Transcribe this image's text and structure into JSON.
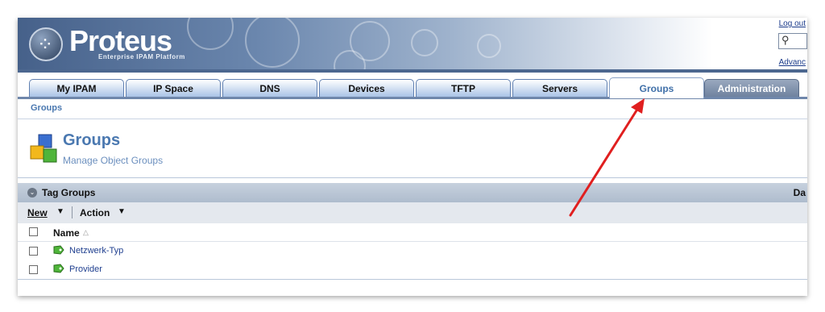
{
  "header": {
    "logo_title": "Proteus",
    "logo_subtitle": "Enterprise IPAM Platform",
    "logout_label": "Log out",
    "advanced_label": "Advanc"
  },
  "tabs": [
    {
      "label": "My IPAM"
    },
    {
      "label": "IP Space"
    },
    {
      "label": "DNS"
    },
    {
      "label": "Devices"
    },
    {
      "label": "TFTP"
    },
    {
      "label": "Servers"
    },
    {
      "label": "Groups"
    },
    {
      "label": "Administration"
    }
  ],
  "active_tab": "Groups",
  "breadcrumb": "Groups",
  "page": {
    "title": "Groups",
    "subtitle": "Manage Object Groups"
  },
  "section": {
    "title": "Tag Groups",
    "right_label": "Da"
  },
  "toolbar": {
    "new_label": "New",
    "action_label": "Action"
  },
  "table": {
    "column_name": "Name",
    "rows": [
      {
        "name": "Netzwerk-Typ"
      },
      {
        "name": "Provider"
      }
    ]
  },
  "colors": {
    "accent": "#4a78b0",
    "annotation_arrow": "#e01f1f"
  }
}
